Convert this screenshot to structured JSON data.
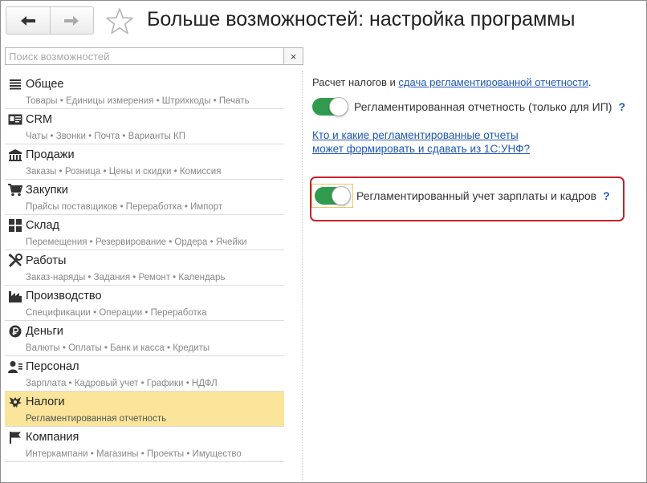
{
  "header": {
    "title": "Больше возможностей: настройка программы",
    "back_icon": "arrow-left-icon",
    "forward_icon": "arrow-right-icon",
    "favorite_icon": "star-outline-icon"
  },
  "search": {
    "placeholder": "Поиск возможностей",
    "clear_label": "×"
  },
  "sections": [
    {
      "title": "Общее",
      "subtitle": "Товары • Единицы измерения • Штрихкоды • Печать",
      "icon": "list-lines-icon"
    },
    {
      "title": "CRM",
      "subtitle": "Чаты • Звонки • Почта • Варианты КП",
      "icon": "contact-card-icon"
    },
    {
      "title": "Продажи",
      "subtitle": "Заказы • Розница • Цены и скидки • Комиссия",
      "icon": "shop-icon"
    },
    {
      "title": "Закупки",
      "subtitle": "Прайсы поставщиков • Переработка • Импорт",
      "icon": "cart-icon"
    },
    {
      "title": "Склад",
      "subtitle": "Перемещения • Резервирование • Ордера • Ячейки",
      "icon": "warehouse-grid-icon"
    },
    {
      "title": "Работы",
      "subtitle": "Заказ-наряды • Задания • Ремонт • Календарь",
      "icon": "tools-icon"
    },
    {
      "title": "Производство",
      "subtitle": "Спецификации • Операции • Переработка",
      "icon": "factory-icon"
    },
    {
      "title": "Деньги",
      "subtitle": "Валюты • Оплаты • Банк и касса • Кредиты",
      "icon": "ruble-coin-icon"
    },
    {
      "title": "Персонал",
      "subtitle": "Зарплата • Кадровый учет • Графики • НДФЛ",
      "icon": "person-icon"
    },
    {
      "title": "Налоги",
      "subtitle": "Регламентированная отчетность",
      "icon": "coat-of-arms-icon",
      "selected": true
    },
    {
      "title": "Компания",
      "subtitle": "Интеркампани • Магазины • Проекты • Имущество",
      "icon": "flag-icon"
    }
  ],
  "panel": {
    "intro_text": "Расчет налогов и ",
    "intro_link": "сдача регламентированной отчетности",
    "intro_end": ".",
    "toggle1": {
      "label": "Регламентированная отчетность (только для ИП)",
      "on": true,
      "help": "?"
    },
    "info_link_line1": "Кто и какие регламентированные отчеты",
    "info_link_line2": "может формировать и сдавать из 1С:УНФ?",
    "toggle2": {
      "label": "Регламентированный учет зарплаты и кадров",
      "on": true,
      "help": "?"
    }
  },
  "colors": {
    "toggle_on": "#2f9b4d",
    "link": "#1f58b3",
    "selected_row": "#fbe59b",
    "highlight_border": "#c8202a"
  }
}
